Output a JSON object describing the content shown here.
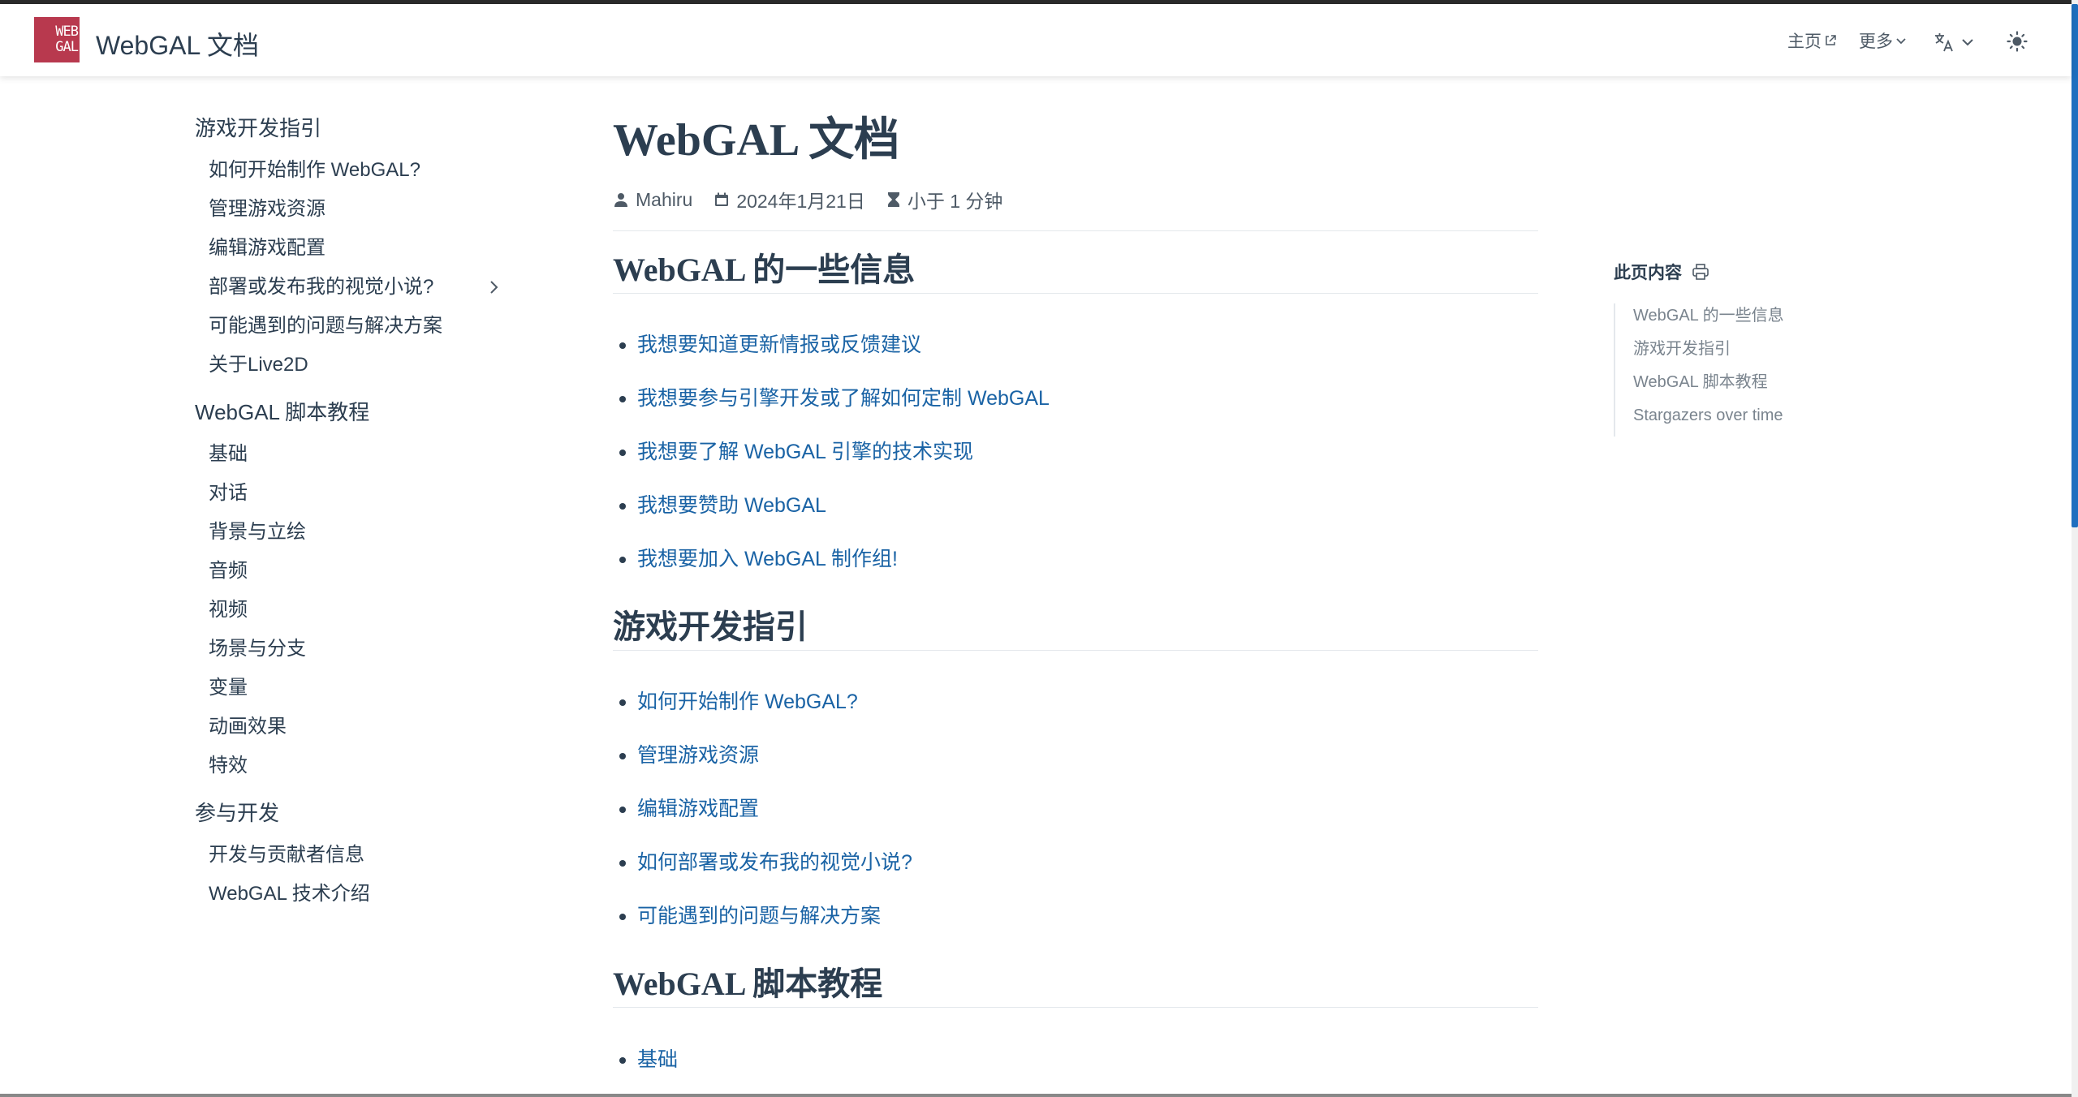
{
  "header": {
    "logo_line1": "WEB",
    "logo_line2": "GAL",
    "site_title": "WebGAL 文档",
    "nav": {
      "home_label": "主页",
      "more_label": "更多"
    }
  },
  "sidebar": {
    "groups": [
      {
        "title": "游戏开发指引",
        "items": [
          "如何开始制作 WebGAL?",
          "管理游戏资源",
          "编辑游戏配置",
          "部署或发布我的视觉小说?",
          "可能遇到的问题与解决方案",
          "关于Live2D"
        ]
      },
      {
        "title": "WebGAL 脚本教程",
        "items": [
          "基础",
          "对话",
          "背景与立绘",
          "音频",
          "视频",
          "场景与分支",
          "变量",
          "动画效果",
          "特效"
        ]
      },
      {
        "title": "参与开发",
        "items": [
          "开发与贡献者信息",
          "WebGAL 技术介绍"
        ]
      }
    ]
  },
  "main": {
    "title": "WebGAL 文档",
    "meta": {
      "author": "Mahiru",
      "date": "2024年1月21日",
      "reading_time": "小于 1 分钟"
    },
    "sections": [
      {
        "heading": "WebGAL 的一些信息",
        "links": [
          "我想要知道更新情报或反馈建议",
          "我想要参与引擎开发或了解如何定制 WebGAL",
          "我想要了解 WebGAL 引擎的技术实现",
          "我想要赞助 WebGAL",
          "我想要加入 WebGAL 制作组!"
        ]
      },
      {
        "heading": "游戏开发指引",
        "links": [
          "如何开始制作 WebGAL?",
          "管理游戏资源",
          "编辑游戏配置",
          "如何部署或发布我的视觉小说?",
          "可能遇到的问题与解决方案"
        ]
      },
      {
        "heading": "WebGAL 脚本教程",
        "links": [
          "基础"
        ]
      }
    ]
  },
  "toc": {
    "title": "此页内容",
    "items": [
      "WebGAL 的一些信息",
      "游戏开发指引",
      "WebGAL 脚本教程",
      "Stargazers over time"
    ]
  },
  "colors": {
    "brand": "#b8394e",
    "link": "#1a63a5",
    "text": "#2c3e50",
    "muted": "#7a848e"
  }
}
